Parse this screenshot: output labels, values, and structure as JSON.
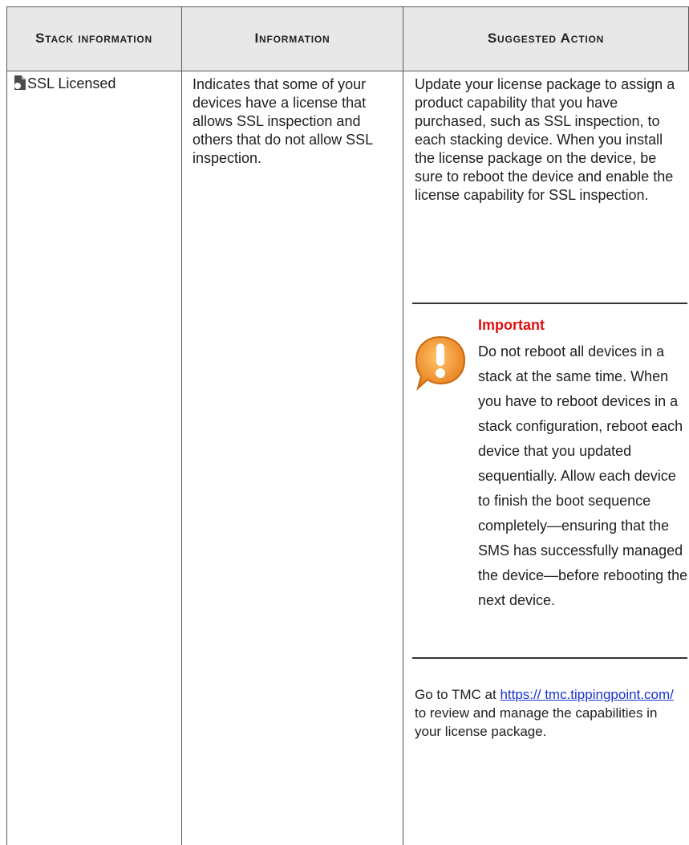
{
  "headers": {
    "stack_information": "Stack information",
    "information": "Information",
    "suggested_action": "Suggested Action"
  },
  "row": {
    "stack_label": "SSL Licensed",
    "stack_icon": "document-icon",
    "information": "Indicates that some of your devices have a license that allows SSL inspection and others that do not allow SSL inspection.",
    "suggested_action": "Update your license package to assign a product capability that you have purchased, such as SSL inspection, to each stacking device. When you install the license package on the device, be sure to reboot the device and enable the license capability for SSL inspection."
  },
  "important": {
    "icon": "warning-exclamation-icon",
    "title": "Important",
    "body": "Do not reboot all devices in a stack at the same time. When you have to reboot devices in a stack configuration, reboot each device that you updated sequentially. Allow each device to finish the boot sequence completely—ensuring that the SMS has successfully managed the device—before rebooting the next device."
  },
  "tmc": {
    "prefix": "Go to TMC at ",
    "link": "https:// tmc.tippingpoint.com/",
    "suffix": " to review and manage the capabilities in your license package."
  },
  "colors": {
    "header_bg": "#e8e8e8",
    "important_title": "#e01010",
    "icon_orange": "#f39a2e",
    "link": "#1b33c9"
  }
}
